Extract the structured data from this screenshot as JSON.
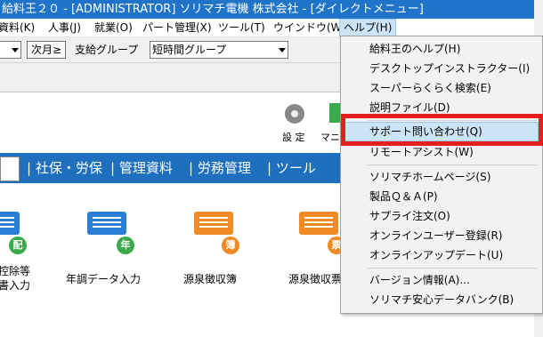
{
  "window": {
    "title": "給料王２０ - [ADMINISTRATOR] ソリマチ電機 株式会社 - [ダイレクトメニュー]"
  },
  "menubar": {
    "items": [
      "資料(K)",
      "人事(J)",
      "就業(O)",
      "パート管理(X)",
      "ツール(T)",
      "ウインドウ(W)",
      "ヘルプ(H)"
    ]
  },
  "toolbar": {
    "next_month": "次月≥",
    "pay_group_label": "支給グループ",
    "pay_group_value": "短時間グループ"
  },
  "top_tools": {
    "settings": "設 定",
    "partial": "マニ"
  },
  "navbar": {
    "tabs": [
      "| 社保・労保",
      "| 管理資料",
      "| 労務管理",
      "| ツール"
    ]
  },
  "icons": [
    {
      "badge": "配",
      "label": "控除等",
      "label2": "書入力",
      "color": "#2a7fd4",
      "badge_color": "#3aaa4a"
    },
    {
      "badge": "年",
      "label": "年調データ入力",
      "color": "#2a7fd4",
      "badge_color": "#3aaa4a"
    },
    {
      "badge": "簿",
      "label": "源泉徴収簿",
      "color": "#f08a24",
      "badge_color": "#f08a24"
    },
    {
      "badge": "票",
      "label": "源泉徴収票",
      "color": "#f08a24",
      "badge_color": "#f08a24"
    }
  ],
  "help_menu": {
    "items": [
      "給料王のヘルプ(H)",
      "デスクトップインストラクター(I)",
      "スーパーらくらく検索(E)",
      "説明ファイル(D)",
      "サポート問い合わせ(Q)",
      "リモートアシスト(W)",
      "ソリマチホームページ(S)",
      "製品Ｑ＆Ａ(P)",
      "サプライ注文(O)",
      "オンラインユーザー登録(R)",
      "オンラインアップデート(U)",
      "バージョン情報(A)...",
      "ソリマチ安心データバンク(B)"
    ],
    "highlighted_index": 4
  },
  "colors": {
    "title_bar": "#1f74c9",
    "nav_bar": "#1f6fbf",
    "highlight_box": "#e61e1e",
    "hover": "#cce4f7"
  }
}
